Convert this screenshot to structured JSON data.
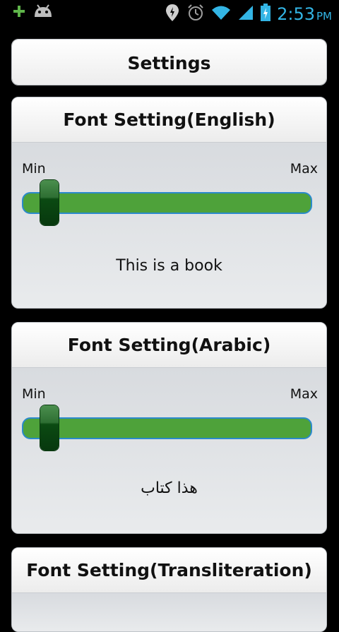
{
  "status_bar": {
    "left_icons": [
      "plus-icon",
      "android-debug-icon"
    ],
    "right_icons": [
      "location-icon",
      "alarm-icon",
      "wifi-icon",
      "signal-icon",
      "battery-charging-icon"
    ],
    "time": "2:53",
    "ampm": "PM",
    "accent_color": "#33b5e5"
  },
  "header": {
    "title": "Settings"
  },
  "sections": [
    {
      "title": "Font Setting(English)",
      "min_label": "Min",
      "max_label": "Max",
      "slider_level": 0,
      "sample_text": "This is a book"
    },
    {
      "title": "Font Setting(Arabic)",
      "min_label": "Min",
      "max_label": "Max",
      "slider_level": 0,
      "sample_text": "هذا كتاب"
    },
    {
      "title": "Font Setting(Transliteration)"
    }
  ],
  "colors": {
    "track": "#4ea23a",
    "track_border": "#2b8acb",
    "thumb": "#0b4a12"
  }
}
